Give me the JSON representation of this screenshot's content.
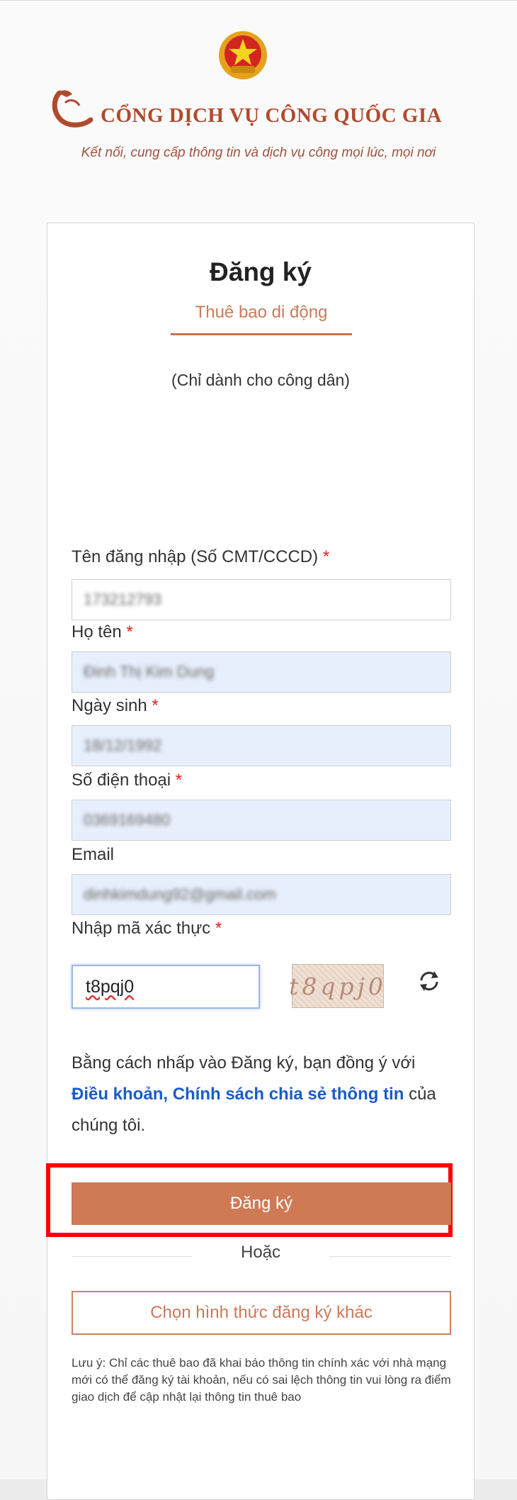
{
  "header": {
    "site_title": "CỔNG DỊCH VỤ CÔNG QUỐC GIA",
    "slogan": "Kết nối, cung cấp thông tin và dịch vụ công mọi lúc, mọi nơi"
  },
  "form": {
    "title": "Đăng ký",
    "tab_label": "Thuê bao di động",
    "note": "(Chỉ dành cho công dân)",
    "required_mark": "*",
    "fields": {
      "username": {
        "label": "Tên đăng nhập (Số CMT/CCCD)",
        "value": "173212793"
      },
      "fullname": {
        "label": "Họ tên",
        "value": "Đinh Thị Kim Dung"
      },
      "dob": {
        "label": "Ngày sinh",
        "value": "18/12/1992"
      },
      "phone": {
        "label": "Số điện thoại",
        "value": "0369169480"
      },
      "email": {
        "label": "Email",
        "value": "dinhkimdung92@gmail.com"
      },
      "captcha": {
        "label": "Nhập mã xác thực",
        "value": "t8pqj0",
        "image_text": "t8qpj0"
      }
    },
    "terms": {
      "prefix": "Bằng cách nhấp vào Đăng ký, bạn đồng ý với",
      "link": "Điều khoản, Chính sách chia sẻ thông tin",
      "suffix": "của chúng tôi."
    },
    "submit_label": "Đăng ký",
    "or_label": "Hoặc",
    "alt_label": "Chọn hình thức đăng ký khác",
    "footnote": "Lưu ý: Chỉ các thuê bao đã khai báo thông tin chính xác với nhà mạng mới có thể đăng ký tài khoản, nếu có sai lệch thông tin vui lòng ra điểm giao dịch để cập nhật lại thông tin thuê bao"
  },
  "colors": {
    "accent": "#cf7a55",
    "brand": "#b04a2c",
    "link": "#1a5cc8",
    "highlight": "#ff0000"
  }
}
